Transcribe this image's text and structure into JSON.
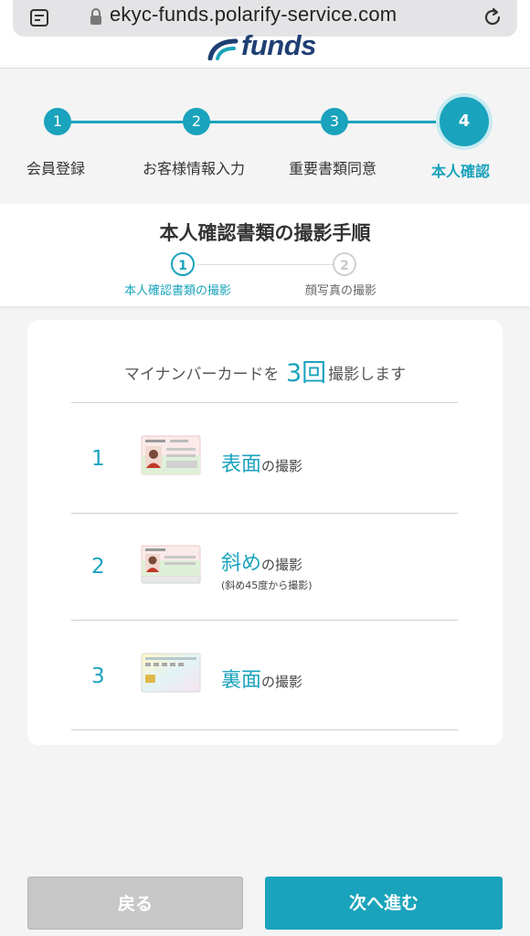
{
  "browser": {
    "url": "ekyc-funds.polarify-service.com"
  },
  "brand": {
    "logo_text": "funds",
    "accent_color": "#1aa3bc",
    "logo_color": "#1f3f73"
  },
  "stepper": {
    "steps": [
      {
        "number": "1",
        "label": "会員登録"
      },
      {
        "number": "2",
        "label": "お客様情報入力"
      },
      {
        "number": "3",
        "label": "重要書類同意"
      },
      {
        "number": "4",
        "label": "本人確認"
      }
    ],
    "active_step": "4"
  },
  "instructions": {
    "title": "本人確認書類の撮影手順",
    "substeps": [
      {
        "number": "1",
        "label": "本人確認書類の撮影"
      },
      {
        "number": "2",
        "label": "顔写真の撮影"
      }
    ],
    "intro_prefix": "マイナンバーカードを",
    "intro_count": "3",
    "intro_unit": "回",
    "intro_suffix": "撮影します",
    "photos": [
      {
        "number": "1",
        "emphasis": "表面",
        "suffix": "の撮影",
        "note": "",
        "icon": "card-front-icon"
      },
      {
        "number": "2",
        "emphasis": "斜め",
        "suffix": "の撮影",
        "note": "(斜め45度から撮影)",
        "icon": "card-angled-icon"
      },
      {
        "number": "3",
        "emphasis": "裏面",
        "suffix": "の撮影",
        "note": "",
        "icon": "card-back-icon"
      }
    ]
  },
  "buttons": {
    "back": "戻る",
    "next": "次へ進む"
  }
}
